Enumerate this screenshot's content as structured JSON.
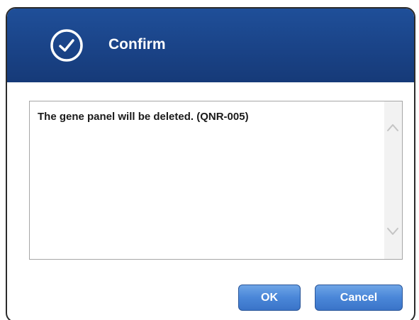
{
  "dialog": {
    "title": "Confirm",
    "title_icon": "check-circle-icon",
    "message": "The gene panel will be deleted. (QNR-005)",
    "scroll_up_icon": "chevron-up-icon",
    "scroll_down_icon": "chevron-down-icon",
    "buttons": {
      "ok_label": "OK",
      "cancel_label": "Cancel"
    }
  },
  "colors": {
    "titlebar": "#1a4387",
    "button": "#4a86d8",
    "button_text": "#ffffff",
    "message_text": "#1a1a1a"
  }
}
